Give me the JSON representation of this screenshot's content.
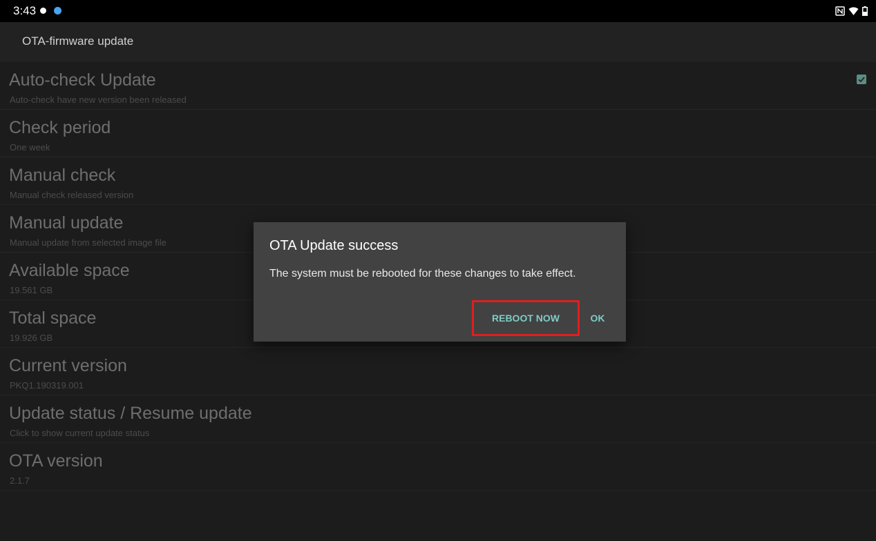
{
  "status_bar": {
    "time": "3:43",
    "icons_left": [
      "notification-dot-icon",
      "globe-icon"
    ],
    "icons_right": [
      "nfc-icon",
      "wifi-icon",
      "battery-icon"
    ]
  },
  "action_bar": {
    "title": "OTA-firmware update"
  },
  "preferences": [
    {
      "title": "Auto-check Update",
      "summary": "Auto-check have new version been released",
      "checked": true
    },
    {
      "title": "Check period",
      "summary": "One week"
    },
    {
      "title": "Manual check",
      "summary": "Manual check released version"
    },
    {
      "title": "Manual update",
      "summary": "Manual update from selected image file"
    },
    {
      "title": "Available space",
      "summary": "19.561 GB"
    },
    {
      "title": "Total space",
      "summary": "19.926 GB"
    },
    {
      "title": "Current version",
      "summary": "PKQ1.190319.001"
    },
    {
      "title": "Update status / Resume update",
      "summary": "Click to show current update status"
    },
    {
      "title": "OTA version",
      "summary": "2.1.7"
    }
  ],
  "dialog": {
    "title": "OTA Update success",
    "message": "The system must be rebooted for these changes to take effect.",
    "reboot_label": "REBOOT NOW",
    "ok_label": "OK"
  },
  "colors": {
    "accent": "#80cbc4",
    "highlight_box": "#e01e1e",
    "dialog_bg": "#424242",
    "checkbox": "#5a8d86"
  }
}
